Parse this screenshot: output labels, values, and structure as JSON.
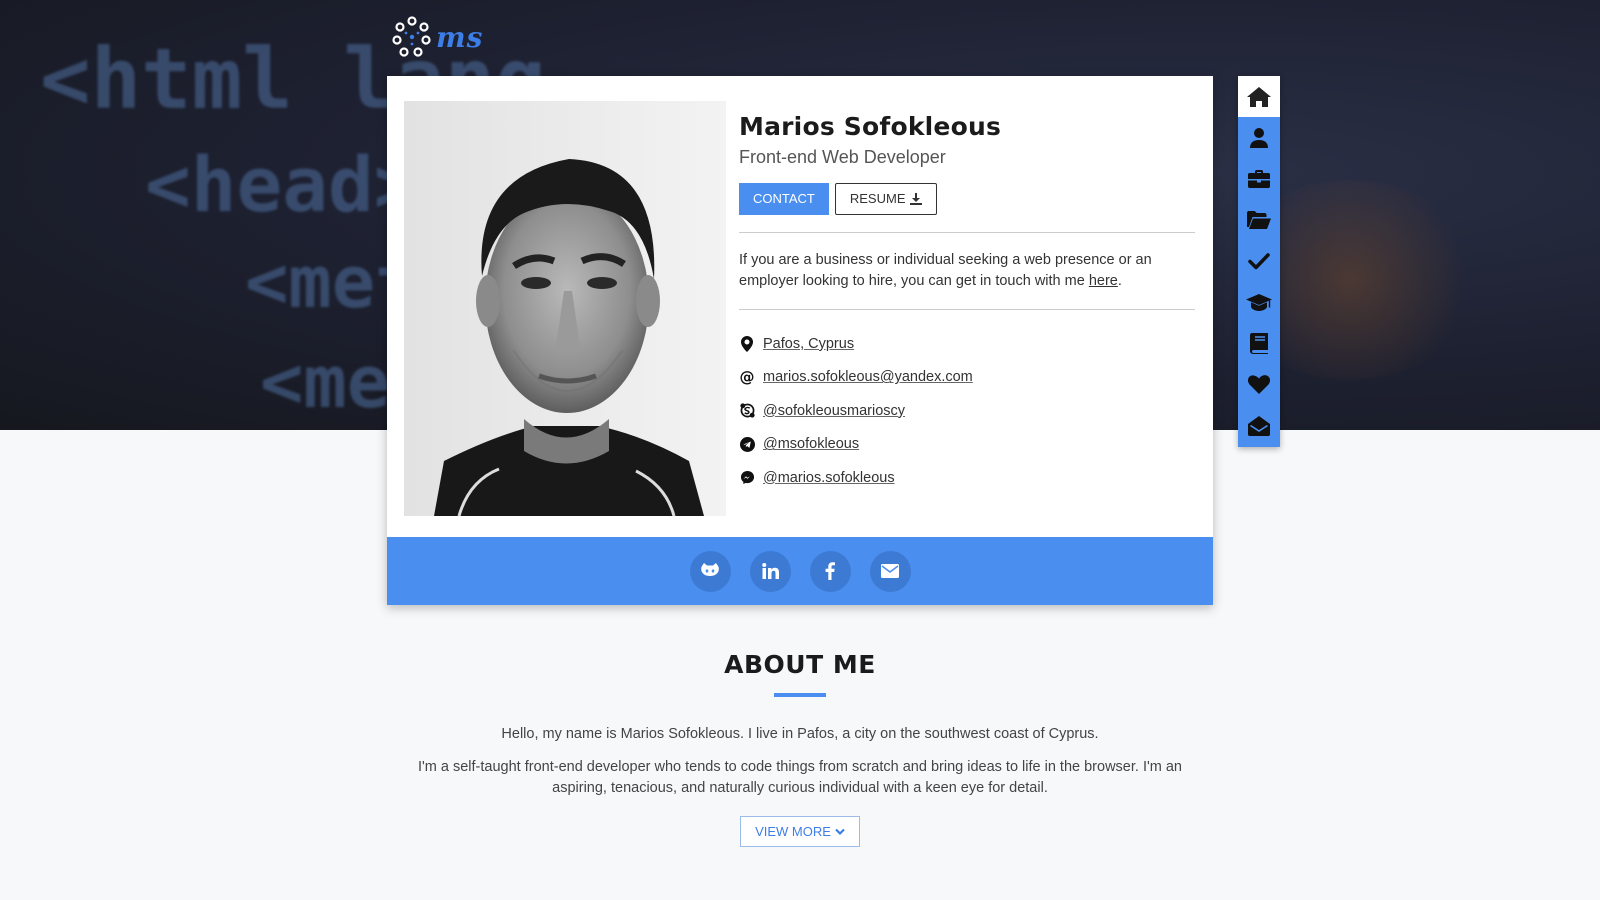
{
  "hero": {
    "code_lines": [
      "<html lang",
      "<head>",
      "<met",
      "<met"
    ]
  },
  "logo": {
    "text": "ms"
  },
  "profile": {
    "name": "Marios Sofokleous",
    "role": "Front-end Web Developer",
    "contact_label": "CONTACT",
    "resume_label": "RESUME",
    "pitch_text": "If you are a business or individual seeking a web presence or an employer looking to hire, you can get in touch with me ",
    "pitch_link": "here",
    "pitch_end": ".",
    "contacts": [
      {
        "icon": "map-marker-icon",
        "text": "Pafos, Cyprus"
      },
      {
        "icon": "at-icon",
        "text": "marios.sofokleous@yandex.com"
      },
      {
        "icon": "skype-icon",
        "text": "@sofokleousmarioscy"
      },
      {
        "icon": "telegram-icon",
        "text": "@msofokleous"
      },
      {
        "icon": "messenger-icon",
        "text": "@marios.sofokleous"
      }
    ]
  },
  "social": [
    "github-icon",
    "linkedin-icon",
    "facebook-icon",
    "envelope-icon"
  ],
  "sidenav": [
    "home-icon",
    "user-icon",
    "briefcase-icon",
    "folder-open-icon",
    "check-icon",
    "graduation-cap-icon",
    "book-icon",
    "heart-icon",
    "envelope-open-icon"
  ],
  "about": {
    "title": "ABOUT ME",
    "p1": "Hello, my name is Marios Sofokleous. I live in Pafos, a city on the southwest coast of Cyprus.",
    "p2": "I'm a self-taught front-end developer who tends to code things from scratch and bring ideas to life in the browser. I'm an aspiring, tenacious, and naturally curious individual with a keen eye for detail.",
    "view_more": "VIEW MORE"
  },
  "colors": {
    "accent": "#4a8ff0",
    "dark": "#1b1b1b"
  }
}
